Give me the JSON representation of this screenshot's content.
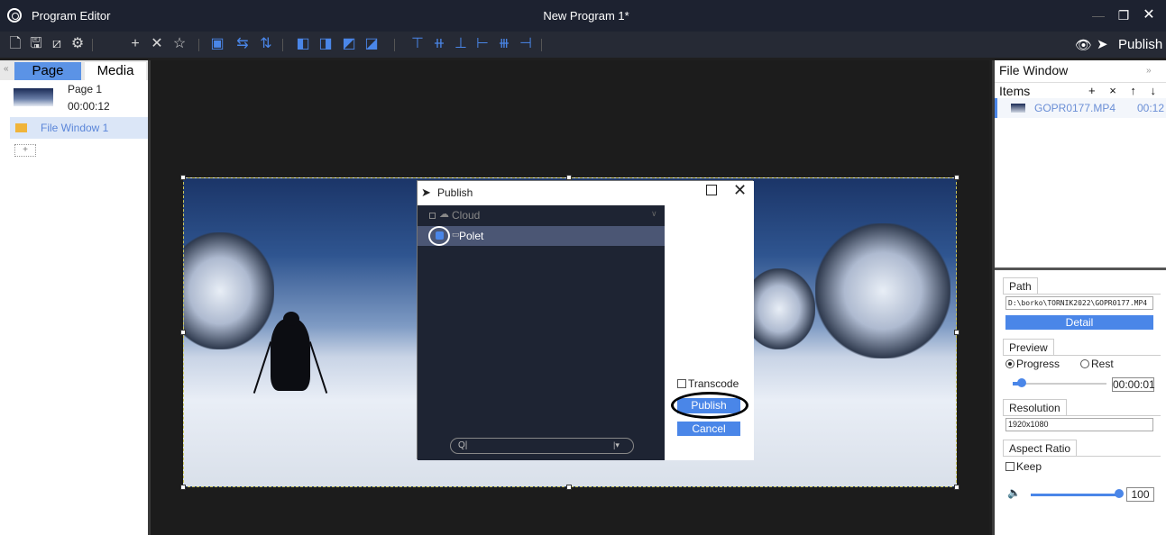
{
  "titlebar": {
    "app_title": "Program Editor",
    "doc_title": "New Program 1*"
  },
  "toolbar": {
    "publish_label": "Publish"
  },
  "left_panel": {
    "tab_page": "Page",
    "tab_media": "Media",
    "page": {
      "name": "Page 1",
      "duration": "00:00:12"
    },
    "layer": {
      "label": "File Window 1"
    },
    "add_label": "+"
  },
  "publish_dialog": {
    "title": "Publish",
    "cloud_label": "Cloud",
    "device_label": "Polet",
    "transcode_label": "Transcode",
    "publish_button": "Publish",
    "cancel_button": "Cancel",
    "search_icon": "Q|",
    "search_dropdown": "|▾"
  },
  "right_panel": {
    "header": "File Window",
    "items_label": "Items",
    "items_actions": "+ × ↑ ↓",
    "item": {
      "name": "GOPR0177.MP4",
      "duration": "00:12"
    },
    "path_tab": "Path",
    "path_value": "D:\\borko\\TORNIK2022\\GOPR0177.MP4",
    "detail_button": "Detail",
    "preview_tab": "Preview",
    "progress_label": "Progress",
    "rest_label": "Rest",
    "preview_time": "00:00:01",
    "preview_progress_fraction": 0.08,
    "resolution_tab": "Resolution",
    "resolution_value": "1920x1080",
    "aspect_tab": "Aspect Ratio",
    "keep_label": "Keep",
    "volume": "100"
  },
  "colors": {
    "accent": "#4a86e8",
    "titlebar": "#1d2230",
    "dialog_list_bg": "#1e2433"
  }
}
